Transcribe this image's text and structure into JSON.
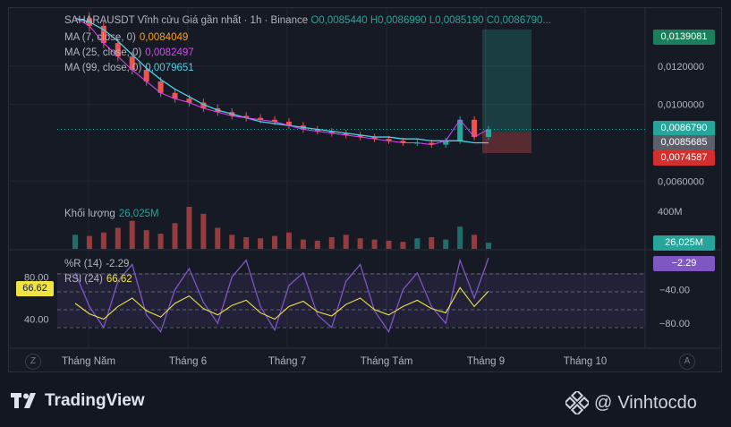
{
  "header": {
    "symbol_line": "SAHARAUSDT Vĩnh cửu Giá gần nhất · 1h · Binance",
    "open_label": "O",
    "open": "0,0085440",
    "high_label": "H",
    "high": "0,0086990",
    "low_label": "L",
    "low": "0,0085190",
    "close_label": "C",
    "close": "0,0086790..."
  },
  "ma_legend": [
    {
      "label": "MA (7, close, 0)",
      "value": "0,0084049",
      "color": "#f7a21b"
    },
    {
      "label": "MA (25, close, 0)",
      "value": "0,0082497",
      "color": "#e040fb"
    },
    {
      "label": "MA (99, close, 0)",
      "value": "0,0079651",
      "color": "#4dd0e1"
    }
  ],
  "volume_legend": {
    "label": "Khối lượng",
    "value": "26,025M"
  },
  "osc_legend": [
    {
      "label": "%R (14)",
      "value": "-2.29",
      "color": "#b2b5be"
    },
    {
      "label": "RSI (24)",
      "value": "66.62",
      "color": "#f0e442"
    }
  ],
  "price_tags": [
    {
      "name": "target-price-tag",
      "value": "0,0139081",
      "color": "#1b7f5a"
    },
    {
      "name": "last-price-tag",
      "value": "0,0086790",
      "color": "#26a69a"
    },
    {
      "name": "entry-price-tag",
      "value": "0,0085685",
      "color": "#5d606b"
    },
    {
      "name": "stop-price-tag",
      "value": "0,0074587",
      "color": "#d32f2f"
    },
    {
      "name": "volume-tag",
      "value": "26,025M",
      "color": "#26a69a"
    },
    {
      "name": "williams-r-tag",
      "value": "−2.29",
      "color": "#7e57c2"
    },
    {
      "name": "rsi-tag",
      "value": "66.62",
      "color": "#f0e442"
    }
  ],
  "colors": {
    "up": "#26a69a",
    "down": "#ef5350",
    "ma7": "#f7a21b",
    "ma25": "#e040fb",
    "ma99": "#4dd0e1",
    "williams": "#7e57c2",
    "rsi": "#f0e442"
  },
  "chart_data": {
    "type": "line",
    "title": "SAHARAUSDT Vĩnh cửu Giá gần nhất · 1h · Binance",
    "x_ticks": [
      "Tháng Năm",
      "Tháng 6",
      "Tháng 7",
      "Tháng Tám",
      "Tháng 9",
      "Tháng 10"
    ],
    "price_axis": {
      "ticks": [
        "0,0120000",
        "0,0100000",
        "0,0060000"
      ],
      "tick_values": [
        0.012,
        0.01,
        0.006
      ],
      "ylim": [
        0.0048,
        0.0147
      ]
    },
    "volume_axis": {
      "ticks": [
        "400M"
      ],
      "tick_values": [
        400
      ]
    },
    "osc_left_axis": {
      "ticks": [
        "80.00",
        "40.00"
      ],
      "tick_values": [
        80,
        40
      ]
    },
    "osc_right_axis": {
      "ticks": [
        "−40.00",
        "−80.00"
      ],
      "tick_values": [
        -40,
        -80
      ]
    },
    "price_series": {
      "name": "SAHARAUSDT",
      "x": [
        0,
        1,
        2,
        3,
        4,
        5,
        6,
        7,
        8,
        9,
        10,
        11,
        12,
        13,
        14,
        15,
        16,
        17,
        18,
        19,
        20,
        21,
        22,
        23,
        24,
        25,
        26,
        27,
        28,
        29
      ],
      "values": [
        0.0145,
        0.0141,
        0.0132,
        0.0125,
        0.0118,
        0.0112,
        0.0106,
        0.0103,
        0.0101,
        0.0098,
        0.0096,
        0.0094,
        0.0093,
        0.0092,
        0.0091,
        0.0089,
        0.0087,
        0.0086,
        0.0085,
        0.0084,
        0.0083,
        0.0082,
        0.0081,
        0.008,
        0.008,
        0.0079,
        0.0081,
        0.0092,
        0.0083,
        0.0087
      ]
    },
    "ma99_series": {
      "name": "MA (99, close, 0)",
      "values": [
        0.0145,
        0.0143,
        0.0139,
        0.0133,
        0.0126,
        0.0119,
        0.0113,
        0.0108,
        0.0104,
        0.01,
        0.0097,
        0.0095,
        0.0093,
        0.0091,
        0.009,
        0.0089,
        0.0088,
        0.0087,
        0.0086,
        0.0085,
        0.0084,
        0.0083,
        0.0083,
        0.0082,
        0.0082,
        0.0081,
        0.0081,
        0.0081,
        0.008,
        0.008
      ]
    },
    "position": {
      "target": 0.0139081,
      "entry": 0.0085685,
      "stop": 0.0074587
    },
    "volume_millions": [
      60,
      55,
      70,
      90,
      120,
      80,
      65,
      110,
      180,
      150,
      90,
      60,
      50,
      45,
      55,
      70,
      40,
      35,
      50,
      60,
      45,
      40,
      35,
      30,
      45,
      50,
      40,
      95,
      60,
      26
    ],
    "williams_r": [
      -20,
      -60,
      -85,
      -30,
      -10,
      -70,
      -90,
      -40,
      -15,
      -55,
      -80,
      -25,
      -5,
      -60,
      -88,
      -35,
      -20,
      -70,
      -85,
      -30,
      -10,
      -65,
      -90,
      -40,
      -20,
      -60,
      -80,
      -5,
      -50,
      -2.29
    ],
    "rsi": [
      55,
      45,
      40,
      52,
      60,
      48,
      42,
      55,
      62,
      50,
      44,
      53,
      58,
      46,
      40,
      52,
      57,
      47,
      43,
      54,
      60,
      49,
      44,
      52,
      58,
      50,
      46,
      70,
      52,
      66.62
    ]
  }
}
